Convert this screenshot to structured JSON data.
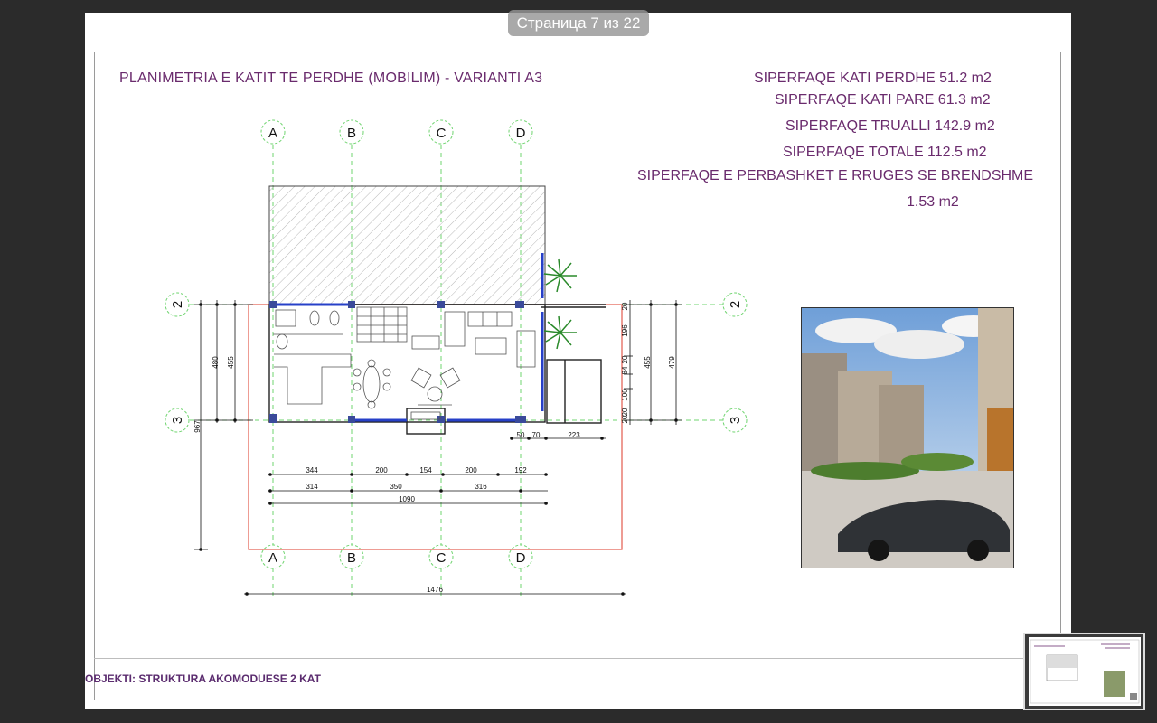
{
  "viewer": {
    "page_indicator": "Страница 7 из 22"
  },
  "drawing": {
    "title": "PLANIMETRIA E KATIT TE PERDHE (MOBILIM) - VARIANTI A3",
    "areas": [
      "SIPERFAQE KATI PERDHE  51.2 m2",
      "SIPERFAQE KATI PARE  61.3 m2",
      "SIPERFAQE TRUALLI  142.9 m2",
      "SIPERFAQE TOTALE  112.5 m2",
      "SIPERFAQE E PERBASHKET E RRUGES SE BRENDSHME",
      "1.53 m2"
    ],
    "grid_axes_top": [
      "A",
      "B",
      "C",
      "D"
    ],
    "grid_axes_bottom": [
      "A",
      "B",
      "C",
      "D"
    ],
    "grid_axes_side": [
      "2",
      "3"
    ],
    "dimensions": {
      "left_vertical": [
        "967",
        "480",
        "455"
      ],
      "right_vertical": [
        "196",
        "84",
        "100",
        "455",
        "479"
      ],
      "right_small": [
        "20",
        "20",
        "20",
        "20"
      ],
      "below_wall": [
        "50",
        "70",
        "223"
      ],
      "row1": [
        "344",
        "200",
        "154",
        "200",
        "192"
      ],
      "row2": [
        "314",
        "350",
        "316"
      ],
      "row3": [
        "1090"
      ],
      "overall": [
        "1476"
      ]
    },
    "footer": "OBJEKTI: STRUKTURA AKOMODUESE 2 KAT"
  }
}
